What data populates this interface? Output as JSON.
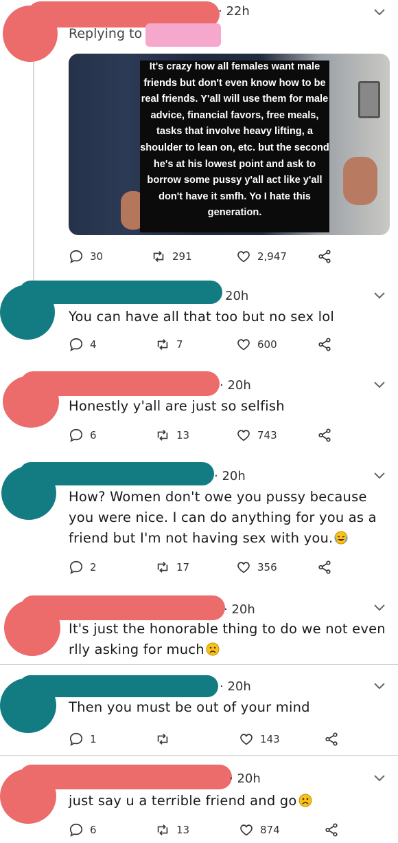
{
  "colors": {
    "red_redaction": "#ec6b6b",
    "teal_redaction": "#137c83",
    "pink_redaction": "#f6a8cc",
    "line": "#cfd8de"
  },
  "top": {
    "time": "· 22h",
    "replying_to": "Replying to",
    "image_text": "It's crazy how all females want male friends but don't even know how to be real friends. Y'all will use them for male advice, financial favors, free meals, tasks that involve heavy lifting, a shoulder to lean on, etc. but the second he's at his lowest point and ask to borrow some pussy y'all act like y'all don't have it smfh. Yo I hate this generation.",
    "replies": "30",
    "retweets": "291",
    "likes": "2,947"
  },
  "tweets": [
    {
      "time": "20h",
      "text": "You can have all that too but no sex lol",
      "replies": "4",
      "retweets": "7",
      "likes": "600"
    },
    {
      "time": "· 20h",
      "text": "Honestly y'all are just so selfish",
      "replies": "6",
      "retweets": "13",
      "likes": "743"
    },
    {
      "time": "· 20h",
      "text": "How? Women don't owe you pussy because you were nice. I can do anything for you as a friend but I'm not having sex with you.",
      "emoji": "laughing-crying-emoji",
      "replies": "2",
      "retweets": "17",
      "likes": "356"
    },
    {
      "time": "· 20h",
      "text": "It's just the honorable thing to do we not even rlly asking for much",
      "emoji": "frowning-face-emoji"
    },
    {
      "time": "· 20h",
      "text": "Then you must be out of your mind",
      "replies": "1",
      "retweets": "",
      "likes": "143"
    },
    {
      "time": "· 20h",
      "text": "just say u a terrible friend and go",
      "emoji": "frowning-face-emoji",
      "replies": "6",
      "retweets": "13",
      "likes": "874"
    }
  ],
  "icons": {
    "reply": "reply-icon",
    "retweet": "retweet-icon",
    "like": "heart-icon",
    "share": "share-icon",
    "more": "chevron-down-icon"
  }
}
